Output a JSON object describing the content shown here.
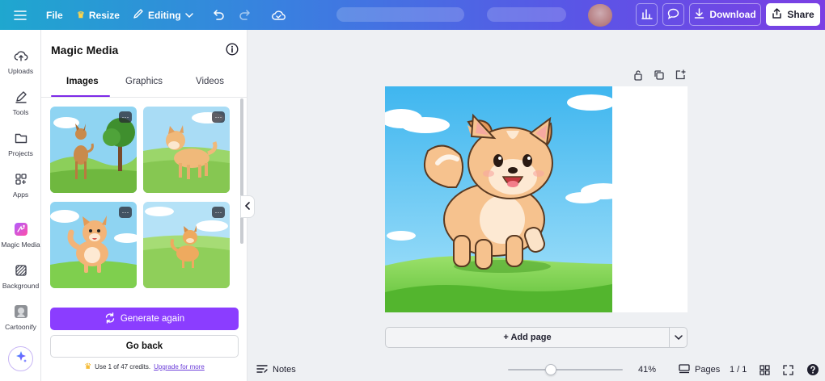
{
  "topbar": {
    "file_label": "File",
    "resize_label": "Resize",
    "editing_label": "Editing",
    "download_label": "Download",
    "share_label": "Share"
  },
  "rail": {
    "items": [
      {
        "label": "Uploads",
        "icon": "upload-icon"
      },
      {
        "label": "Tools",
        "icon": "pen-icon"
      },
      {
        "label": "Projects",
        "icon": "folder-icon"
      },
      {
        "label": "Apps",
        "icon": "apps-icon"
      },
      {
        "label": "Magic Media",
        "icon": "magic-media-icon"
      },
      {
        "label": "Background",
        "icon": "background-icon"
      },
      {
        "label": "Cartoonify",
        "icon": "cartoonify-icon"
      }
    ]
  },
  "panel": {
    "title": "Magic Media",
    "tabs": [
      "Images",
      "Graphics",
      "Videos"
    ],
    "active_tab": "Images",
    "more_glyph": "···",
    "generate_label": "Generate again",
    "back_label": "Go back",
    "credits_text": "Use 1 of 47 credits.",
    "upgrade_label": "Upgrade for more"
  },
  "canvas": {
    "add_page_label": "+ Add page"
  },
  "bottombar": {
    "notes_label": "Notes",
    "zoom_percent": "41%",
    "pages_label": "Pages",
    "page_count": "1 / 1"
  },
  "colors": {
    "accent": "#8b3dff",
    "tab_underline": "#7d2ae8"
  }
}
